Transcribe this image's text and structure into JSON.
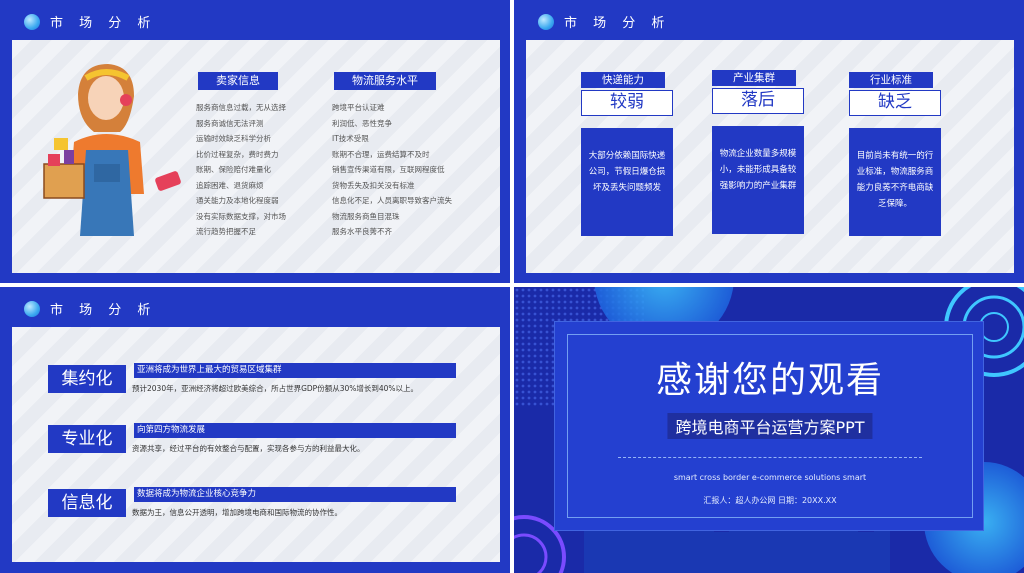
{
  "slide1": {
    "header": "市 场 分 析",
    "seller": {
      "title": "卖家信息",
      "items": [
        "服务商信息过载，无从选择",
        "服务商诚信无法评测",
        "运输时效缺乏科学分析",
        "比价过程复杂，费时费力",
        "账期、保险赔付难量化",
        "追踪困难、退货麻烦",
        "通关能力及本地化程度弱",
        "没有实际数据支撑，对市场",
        "流行趋势把握不足"
      ]
    },
    "logistics": {
      "title": "物流服务水平",
      "items": [
        "跨境平台认证难",
        "利润低、恶性竞争",
        "IT技术受限",
        "账期不合理，运费结算不及时",
        "销售宣传渠道有限，互联网程度低",
        "货物丢失及扣关没有标准",
        "信息化不足，人员离职导致客户流失",
        "物流服务商鱼目混珠",
        "服务水平良莠不齐"
      ]
    }
  },
  "slide2": {
    "header": "市 场 分 析",
    "columns": [
      {
        "label": "快递能力",
        "value": "较弱",
        "desc": "大部分依赖国际快递公司，节假日爆仓损坏及丢失问题频发"
      },
      {
        "label": "产业集群",
        "value": "落后",
        "desc": "物流企业数量多规模小，未能形成具备较强影响力的产业集群"
      },
      {
        "label": "行业标准",
        "value": "缺乏",
        "desc": "目前尚未有统一的行业标准，物流服务商能力良莠不齐电商缺乏保障。"
      }
    ]
  },
  "slide3": {
    "header": "市 场 分 析",
    "rows": [
      {
        "big": "集约化",
        "bar": "亚洲将成为世界上最大的贸易区域集群",
        "sub": "预计2030年，亚洲经济将超过欧美综合，所占世界GDP份额从30%增长到40%以上。"
      },
      {
        "big": "专业化",
        "bar": "向第四方物流发展",
        "sub": "资源共享，经过平台的有效整合与配置，实现各参与方的利益最大化。"
      },
      {
        "big": "信息化",
        "bar": "数据将成为物流企业核心竞争力",
        "sub": "数据为王，信息公开透明，增加跨境电商和国际物流的协作性。"
      }
    ]
  },
  "slide4": {
    "title": "感谢您的观看",
    "subtitle": "跨境电商平台运营方案PPT",
    "english": "smart cross border e-commerce solutions smart",
    "reporter": "汇报人：超人办公网 日期：20XX.XX"
  }
}
